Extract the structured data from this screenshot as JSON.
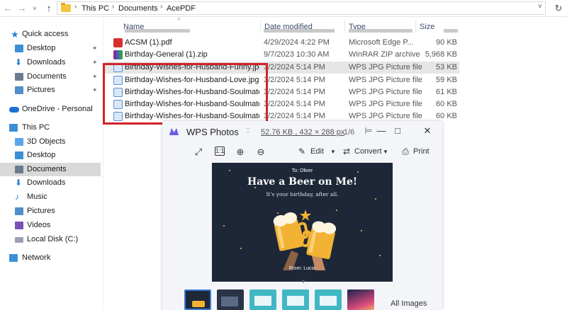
{
  "colors": {
    "accent": "#3a7bd5",
    "highlight_box": "#d3222a",
    "photo_bg": "#1d2737",
    "beer": "#f2b233"
  },
  "nav": {
    "back_icon": "arrow-left-icon",
    "forward_icon": "arrow-right-icon",
    "recent_icon": "chevron-down-icon",
    "up_icon": "arrow-up-icon",
    "breadcrumb": [
      "This PC",
      "Documents",
      "AcePDF"
    ],
    "refresh_icon": "refresh-icon"
  },
  "sidebar": {
    "quick_access": "Quick access",
    "quick_items": [
      {
        "label": "Desktop",
        "icon": "desktop-icon",
        "pinned": true
      },
      {
        "label": "Downloads",
        "icon": "download-icon",
        "pinned": true
      },
      {
        "label": "Documents",
        "icon": "documents-icon",
        "pinned": true
      },
      {
        "label": "Pictures",
        "icon": "pictures-icon",
        "pinned": true
      }
    ],
    "onedrive": "OneDrive - Personal",
    "this_pc": "This PC",
    "pc_items": [
      {
        "label": "3D Objects",
        "icon": "cube-icon"
      },
      {
        "label": "Desktop",
        "icon": "desktop-icon"
      },
      {
        "label": "Documents",
        "icon": "documents-icon",
        "selected": true
      },
      {
        "label": "Downloads",
        "icon": "download-icon"
      },
      {
        "label": "Music",
        "icon": "music-icon"
      },
      {
        "label": "Pictures",
        "icon": "pictures-icon"
      },
      {
        "label": "Videos",
        "icon": "videos-icon"
      },
      {
        "label": "Local Disk (C:)",
        "icon": "disk-icon"
      }
    ],
    "network": "Network"
  },
  "file_list": {
    "columns": [
      "Name",
      "Date modified",
      "Type",
      "Size"
    ],
    "rows": [
      {
        "name": "ACSM (1).pdf",
        "date": "4/29/2024 4:22 PM",
        "type": "Microsoft Edge P...",
        "size": "90 KB",
        "icon": "pdf-icon"
      },
      {
        "name": "Birthday-General (1).zip",
        "date": "9/7/2023 10:30 AM",
        "type": "WinRAR ZIP archive",
        "size": "5,968 KB",
        "icon": "zip-icon"
      },
      {
        "name": "Birthday-Wishes-for-Husband-Funny.jpg",
        "date": "3/2/2024 5:14 PM",
        "type": "WPS JPG Picture file",
        "size": "53 KB",
        "icon": "image-icon",
        "selected": true
      },
      {
        "name": "Birthday-Wishes-for-Husband-Love.jpg",
        "date": "3/2/2024 5:14 PM",
        "type": "WPS JPG Picture file",
        "size": "59 KB",
        "icon": "image-icon"
      },
      {
        "name": "Birthday-Wishes-for-Husband-Soulmate ...",
        "date": "3/2/2024 5:14 PM",
        "type": "WPS JPG Picture file",
        "size": "61 KB",
        "icon": "image-icon"
      },
      {
        "name": "Birthday-Wishes-for-Husband-Soulmate ...",
        "date": "3/2/2024 5:14 PM",
        "type": "WPS JPG Picture file",
        "size": "60 KB",
        "icon": "image-icon"
      },
      {
        "name": "Birthday-Wishes-for-Husband-Soulmate....",
        "date": "3/2/2024 5:14 PM",
        "type": "WPS JPG Picture file",
        "size": "60 KB",
        "icon": "image-icon"
      }
    ]
  },
  "viewer": {
    "title": "WPS Photos",
    "more": "::",
    "info": "52.76 KB , 432 × 288 px",
    "page": "1/6",
    "pin_icon": "pin-icon",
    "min_icon": "minimize-icon",
    "max_icon": "maximize-icon",
    "close_icon": "close-icon",
    "toolbar": {
      "fit_icon": "fit-screen-icon",
      "actual_icon": "actual-size-icon",
      "zoom_in_icon": "zoom-in-icon",
      "zoom_out_icon": "zoom-out-icon",
      "edit": "Edit",
      "convert": "Convert",
      "print": "Print"
    },
    "photo": {
      "to": "To: Oliver",
      "title": "Have a Beer on Me!",
      "subtitle": "It's your birthday, after all.",
      "from": "From: Lucia"
    },
    "thumbnails": 6,
    "all_images": "All Images"
  }
}
